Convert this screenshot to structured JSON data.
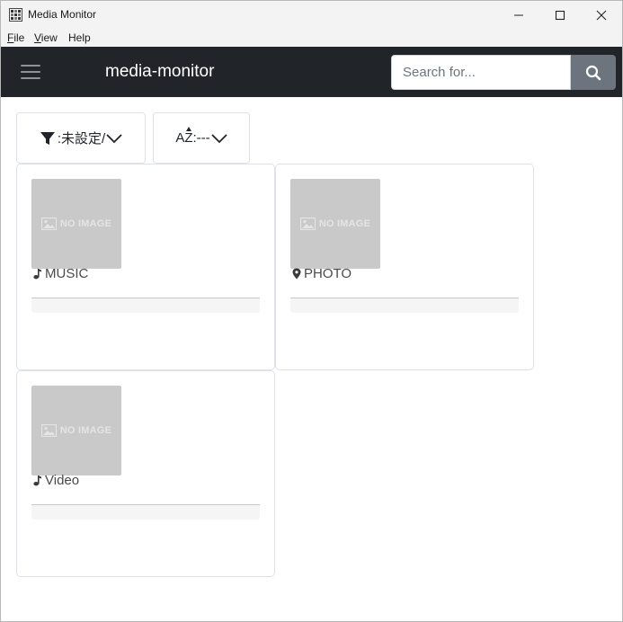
{
  "window": {
    "title": "Media Monitor"
  },
  "menu": {
    "items": [
      {
        "key": "F",
        "rest": "ile"
      },
      {
        "key": "V",
        "rest": "iew"
      },
      {
        "key": "",
        "rest": "Help"
      }
    ]
  },
  "appbar": {
    "brand": "media-monitor",
    "search_placeholder": "Search for..."
  },
  "toolbar": {
    "filter_label": ":未設定/",
    "sort_prefix": "A",
    "sort_label": ":---"
  },
  "cards": [
    {
      "label": "MUSIC",
      "icon": "music-note-icon",
      "thumb_text": "NO IMAGE"
    },
    {
      "label": "PHOTO",
      "icon": "map-pin-icon",
      "thumb_text": "NO IMAGE"
    },
    {
      "label": "Video",
      "icon": "music-note-icon",
      "thumb_text": "NO IMAGE"
    }
  ],
  "colors": {
    "appbar_bg": "#212529",
    "search_button_bg": "#6c757d",
    "thumb_bg": "#c9c9c9"
  }
}
